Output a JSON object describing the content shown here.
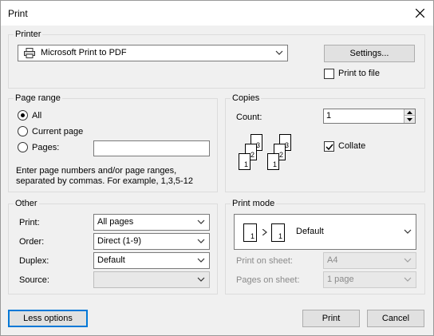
{
  "window": {
    "title": "Print"
  },
  "printer": {
    "group_label": "Printer",
    "selected": "Microsoft Print to PDF",
    "settings_label": "Settings...",
    "print_to_file_label": "Print to file",
    "print_to_file_checked": false
  },
  "page_range": {
    "group_label": "Page range",
    "all_label": "All",
    "current_page_label": "Current page",
    "pages_label": "Pages:",
    "pages_value": "",
    "selected": "All",
    "hint_line1": "Enter page numbers and/or page ranges,",
    "hint_line2": "separated by commas. For example, 1,3,5-12"
  },
  "copies": {
    "group_label": "Copies",
    "count_label": "Count:",
    "count_value": "1",
    "collate_label": "Collate",
    "collate_checked": true,
    "page_numbers": [
      "1",
      "2",
      "3"
    ]
  },
  "other": {
    "group_label": "Other",
    "print_label": "Print:",
    "print_value": "All pages",
    "order_label": "Order:",
    "order_value": "Direct (1-9)",
    "duplex_label": "Duplex:",
    "duplex_value": "Default",
    "source_label": "Source:",
    "source_value": ""
  },
  "print_mode": {
    "group_label": "Print mode",
    "mode_value": "Default",
    "mode_page_number": "1",
    "print_on_sheet_label": "Print on sheet:",
    "print_on_sheet_value": "A4",
    "pages_on_sheet_label": "Pages on sheet:",
    "pages_on_sheet_value": "1 page"
  },
  "footer": {
    "less_options_label": "Less options",
    "print_label": "Print",
    "cancel_label": "Cancel"
  },
  "colors": {
    "focus": "#0078d7",
    "dialog_bg": "#f0f0f0"
  }
}
